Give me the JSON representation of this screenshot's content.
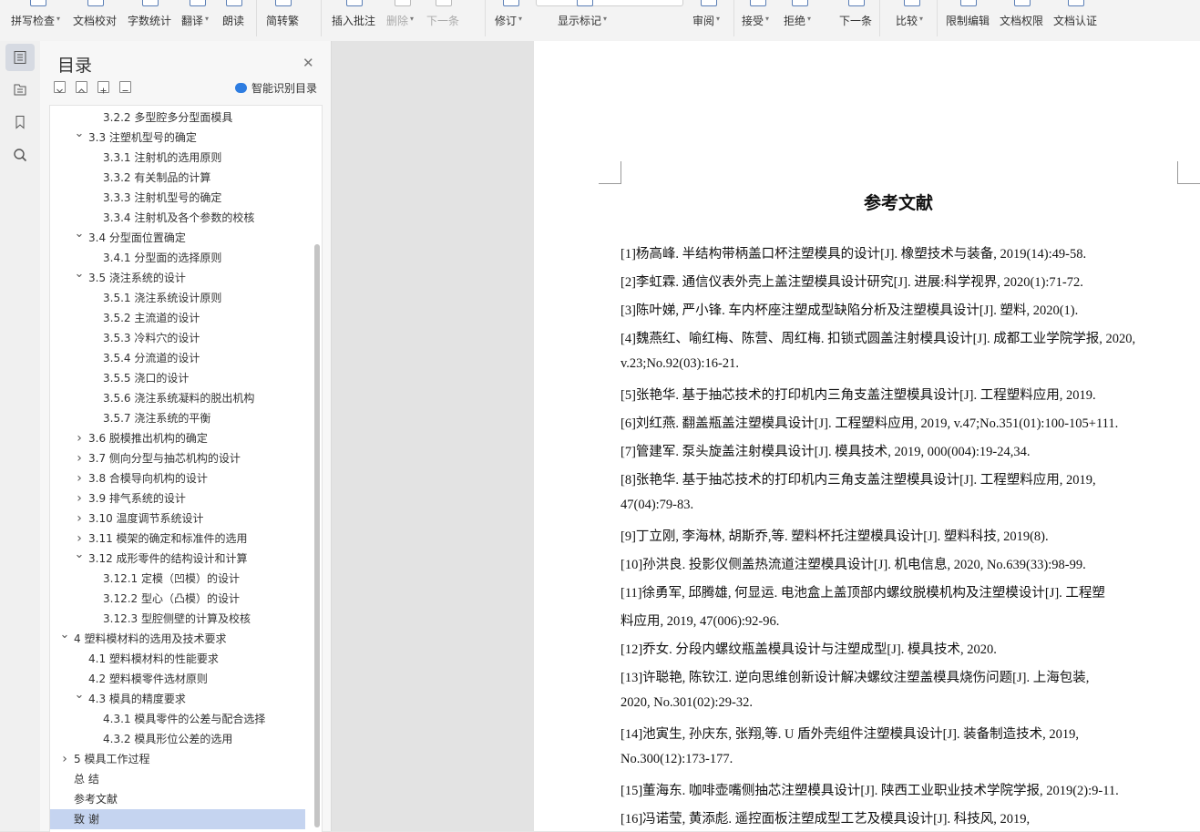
{
  "ribbon": {
    "buttons": [
      {
        "label": "拼写检查",
        "caret": true
      },
      {
        "label": "文档校对",
        "caret": false
      },
      {
        "label": "字数统计",
        "caret": false
      },
      {
        "label": "翻译",
        "caret": true
      },
      {
        "label": "朗读",
        "caret": false
      },
      {
        "label": "简转繁",
        "caret": false
      },
      {
        "label": "插入批注",
        "caret": false
      },
      {
        "label": "删除",
        "caret": true,
        "disabled": true
      },
      {
        "label": "下一条",
        "caret": false,
        "disabled": true
      },
      {
        "label": "修订",
        "caret": true
      },
      {
        "label": "显示标记",
        "caret": true
      },
      {
        "label": "审阅",
        "caret": true
      },
      {
        "label": "接受",
        "caret": true
      },
      {
        "label": "拒绝",
        "caret": true
      },
      {
        "label": "下一条",
        "caret": false
      },
      {
        "label": "比较",
        "caret": true
      },
      {
        "label": "限制编辑",
        "caret": false
      },
      {
        "label": "文档权限",
        "caret": false
      },
      {
        "label": "文档认证",
        "caret": false
      }
    ]
  },
  "rail": {
    "icons": [
      "outline-icon",
      "navigation-icon",
      "bookmark-icon",
      "search-icon"
    ]
  },
  "toc": {
    "title": "目录",
    "smart_label": "智能识别目录",
    "items": [
      {
        "text": "3.2.2  多型腔多分型面模具",
        "level": 3,
        "arrow": ""
      },
      {
        "text": "3.3  注塑机型号的确定",
        "level": 2,
        "arrow": "down"
      },
      {
        "text": "3.3.1  注射机的选用原则",
        "level": 3,
        "arrow": ""
      },
      {
        "text": "3.3.2  有关制品的计算",
        "level": 3,
        "arrow": ""
      },
      {
        "text": "3.3.3  注射机型号的确定",
        "level": 3,
        "arrow": ""
      },
      {
        "text": "3.3.4  注射机及各个参数的校核",
        "level": 3,
        "arrow": ""
      },
      {
        "text": "3.4  分型面位置确定",
        "level": 2,
        "arrow": "down"
      },
      {
        "text": "3.4.1  分型面的选择原则",
        "level": 3,
        "arrow": ""
      },
      {
        "text": "3.5  浇注系统的设计",
        "level": 2,
        "arrow": "down"
      },
      {
        "text": "3.5.1 浇注系统设计原则",
        "level": 3,
        "arrow": ""
      },
      {
        "text": "3.5.2  主流道的设计",
        "level": 3,
        "arrow": ""
      },
      {
        "text": "3.5.3 冷料穴的设计",
        "level": 3,
        "arrow": ""
      },
      {
        "text": "3.5.4  分流道的设计",
        "level": 3,
        "arrow": ""
      },
      {
        "text": "3.5.5 浇口的设计",
        "level": 3,
        "arrow": ""
      },
      {
        "text": "3.5.6  浇注系统凝料的脱出机构",
        "level": 3,
        "arrow": ""
      },
      {
        "text": "3.5.7  浇注系统的平衡",
        "level": 3,
        "arrow": ""
      },
      {
        "text": "3.6  脱模推出机构的确定",
        "level": 2,
        "arrow": "right"
      },
      {
        "text": "3.7  侧向分型与抽芯机构的设计",
        "level": 2,
        "arrow": "right"
      },
      {
        "text": "3.8  合模导向机构的设计",
        "level": 2,
        "arrow": "right"
      },
      {
        "text": "3.9  排气系统的设计",
        "level": 2,
        "arrow": "right"
      },
      {
        "text": "3.10  温度调节系统设计",
        "level": 2,
        "arrow": "right"
      },
      {
        "text": "3.11  模架的确定和标准件的选用",
        "level": 2,
        "arrow": "right"
      },
      {
        "text": "3.12  成形零件的结构设计和计算",
        "level": 2,
        "arrow": "down"
      },
      {
        "text": "3.12.1  定模（凹模）的设计",
        "level": 3,
        "arrow": ""
      },
      {
        "text": "3.12.2    型心（凸模）的设计",
        "level": 3,
        "arrow": ""
      },
      {
        "text": "3.12.3    型腔侧壁的计算及校核",
        "level": 3,
        "arrow": ""
      },
      {
        "text": "4  塑料模材料的选用及技术要求",
        "level": 1,
        "arrow": "down"
      },
      {
        "text": "4.1  塑料模材料的性能要求",
        "level": 2,
        "arrow": ""
      },
      {
        "text": "4.2  塑料模零件选材原则",
        "level": 2,
        "arrow": ""
      },
      {
        "text": "4.3  模具的精度要求",
        "level": 2,
        "arrow": "down"
      },
      {
        "text": "4.3.1  模具零件的公差与配合选择",
        "level": 3,
        "arrow": ""
      },
      {
        "text": "4.3.2  模具形位公差的选用",
        "level": 3,
        "arrow": ""
      },
      {
        "text": "5 模具工作过程",
        "level": 1,
        "arrow": "right"
      },
      {
        "text": "总    结",
        "level": 1,
        "arrow": ""
      },
      {
        "text": "参考文献",
        "level": 1,
        "arrow": ""
      },
      {
        "text": "致    谢",
        "level": 1,
        "arrow": "",
        "selected": true
      }
    ]
  },
  "document": {
    "heading": "参考文献",
    "lines": [
      "[1]杨高峰. 半结构带柄盖口杯注塑模具的设计[J]. 橡塑技术与装备, 2019(14):49-58.",
      "[2]李虹霖. 通信仪表外壳上盖注塑模具设计研究[J]. 进展:科学视界, 2020(1):71-72.",
      "[3]陈叶娣, 严小锋. 车内杯座注塑成型缺陷分析及注塑模具设计[J]. 塑料, 2020(1).",
      "[4]魏燕红、喻红梅、陈营、周红梅. 扣锁式圆盖注射模具设计[J]. 成都工业学院学报, 2020,",
      "v.23;No.92(03):16-21.",
      "[5]张艳华. 基于抽芯技术的打印机内三角支盖注塑模具设计[J]. 工程塑料应用, 2019.",
      "[6]刘红燕. 翻盖瓶盖注塑模具设计[J]. 工程塑料应用, 2019, v.47;No.351(01):100-105+111.",
      "[7]管建军. 泵头旋盖注射模具设计[J]. 模具技术, 2019, 000(004):19-24,34.",
      "[8]张艳华. 基于抽芯技术的打印机内三角支盖注塑模具设计[J]. 工程塑料应用, 2019,",
      "47(04):79-83.",
      "[9]丁立刚, 李海林, 胡斯乔,等. 塑料杯托注塑模具设计[J]. 塑料科技, 2019(8).",
      "[10]孙洪良. 投影仪侧盖热流道注塑模具设计[J]. 机电信息, 2020, No.639(33):98-99.",
      "[11]徐勇军, 邱腾雄, 何显运. 电池盒上盖顶部内螺纹脱模机构及注塑模设计[J]. 工程塑",
      "料应用, 2019, 47(006):92-96.",
      "[12]乔女. 分段内螺纹瓶盖模具设计与注塑成型[J]. 模具技术, 2020.",
      "[13]许聪艳, 陈钦江. 逆向思维创新设计解决螺纹注塑盖模具烧伤问题[J]. 上海包装,",
      "2020, No.301(02):29-32.",
      "[14]池寅生, 孙庆东, 张翔,等. U 盾外壳组件注塑模具设计[J]. 装备制造技术, 2019,",
      "No.300(12):173-177.",
      "[15]董海东. 咖啡壶嘴侧抽芯注塑模具设计[J]. 陕西工业职业技术学院学报, 2019(2):9-11.",
      "[16]冯诺莹, 黄添彪. 遥控面板注塑成型工艺及模具设计[J]. 科技风, 2019,"
    ]
  }
}
